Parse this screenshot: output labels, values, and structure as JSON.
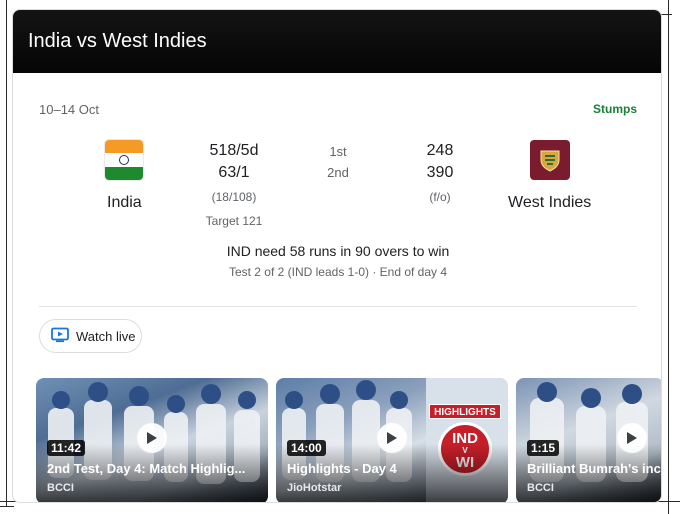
{
  "header": {
    "title": "India vs West Indies"
  },
  "match": {
    "dates": "10–14 Oct",
    "status": "Stumps",
    "team1": {
      "name": "India",
      "score1": "518/5d",
      "score2": "63/1",
      "overs": "(18/108)",
      "target": "Target 121"
    },
    "team2": {
      "name": "West Indies",
      "score1": "248",
      "score2": "390",
      "note": "(f/o)"
    },
    "innings": {
      "first": "1st",
      "second": "2nd"
    },
    "summary": "IND need 58 runs in 90 overs to win",
    "series": "Test 2 of 2 (IND leads 1-0) · End of day 4"
  },
  "watch_live": {
    "label": "Watch live"
  },
  "videos": [
    {
      "duration": "11:42",
      "title": "2nd Test, Day 4: Match Highlig...",
      "source": "BCCI"
    },
    {
      "duration": "14:00",
      "title": "Highlights - Day 4",
      "source": "JioHotstar",
      "badge_text": "HIGHLIGHTS",
      "badge_team1": "IND",
      "badge_vs": "V",
      "badge_team2": "WI"
    },
    {
      "duration": "1:15",
      "title": "Brilliant Bumrah's inci",
      "source": "BCCI"
    }
  ],
  "icons": {
    "flag": "india-flag-icon",
    "team_logo": "west-indies-logo-icon",
    "watch": "tv-play-icon",
    "play": "play-icon"
  },
  "colors": {
    "status": "#188038",
    "header_bg": "#0a0a0a",
    "wi_maroon": "#7b1b2e"
  }
}
